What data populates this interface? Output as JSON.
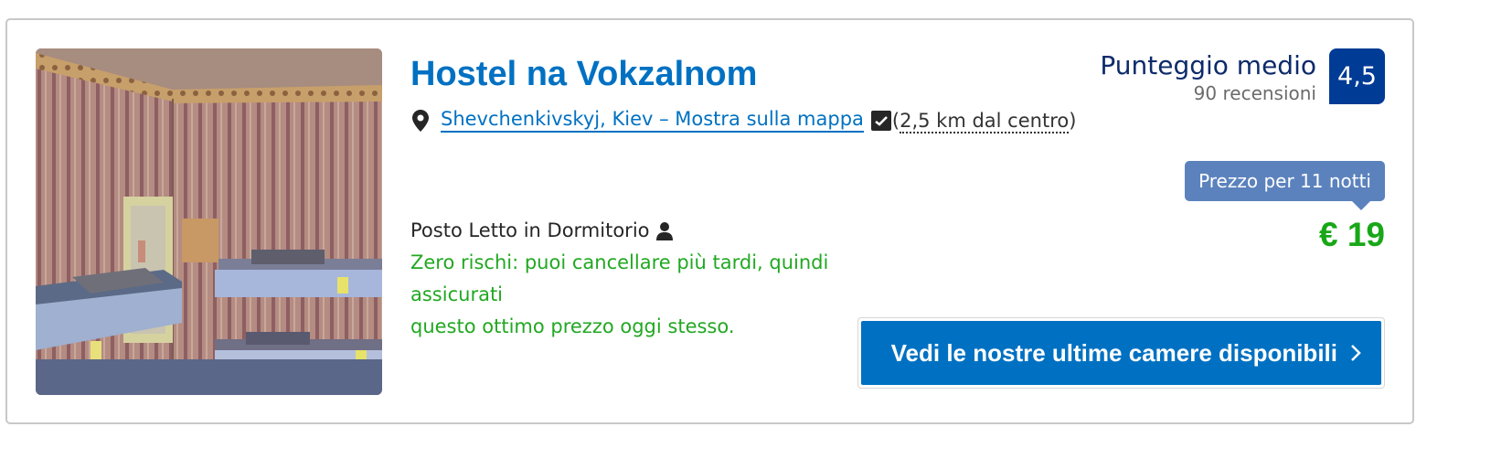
{
  "hotel": {
    "name": "Hostel na Vokzalnom",
    "location_link": "Shevchenkivskyj, Kiev – Mostra sulla mappa",
    "distance_open": "(",
    "distance": "2,5 km dal centro",
    "distance_close": ")"
  },
  "score": {
    "label": "Punteggio medio",
    "reviews": "90 recensioni",
    "value": "4,5"
  },
  "room": {
    "name": "Posto Letto in Dormitorio",
    "cancel_line1": "Zero rischi: puoi cancellare più tardi, quindi assicurati",
    "cancel_line2": "questo ottimo prezzo oggi stesso."
  },
  "price": {
    "tag": "Prezzo per 11 notti",
    "value": "€ 19"
  },
  "cta": {
    "label": "Vedi le nostre ultime camere disponibili"
  },
  "colors": {
    "link": "#0071c2",
    "score_badge": "#003b95",
    "price_green": "#18a718",
    "cancel_green": "#21a821",
    "price_tag_bg": "#5b82bd"
  },
  "icons": {
    "location": "map-pin-icon",
    "map": "map-check-icon",
    "occupancy": "person-icon",
    "cta_arrow": "chevron-right-icon"
  }
}
